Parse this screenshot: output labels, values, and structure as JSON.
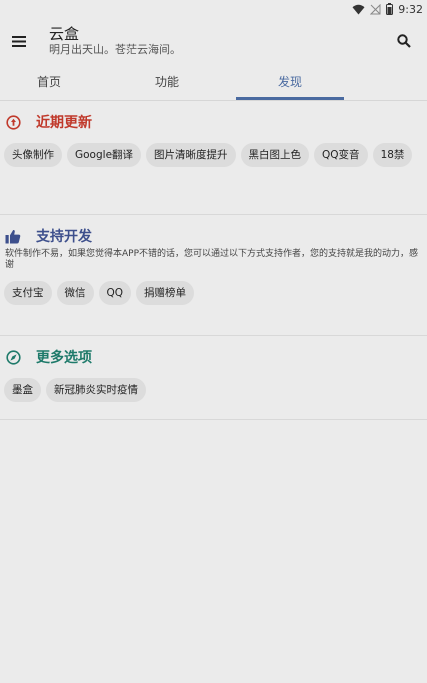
{
  "status": {
    "time": "9:32"
  },
  "app": {
    "title": "云盒",
    "subtitle": "明月出天山。苍茫云海间。"
  },
  "tabs": [
    {
      "label": "首页"
    },
    {
      "label": "功能"
    },
    {
      "label": "发现"
    }
  ],
  "sections": [
    {
      "title": "近期更新",
      "color": "#c0392b",
      "icon": "arrow-up-circle-icon",
      "chips": [
        "头像制作",
        "Google翻译",
        "图片清晰度提升",
        "黑白图上色",
        "QQ变音",
        "18禁"
      ]
    },
    {
      "title": "支持开发",
      "color": "#3d4f8c",
      "icon": "thumbs-up-icon",
      "description": "软件制作不易，如果您觉得本APP不错的话，您可以通过以下方式支持作者，您的支持就是我的动力，感谢",
      "chips": [
        "支付宝",
        "微信",
        "QQ",
        "捐赠榜单"
      ]
    },
    {
      "title": "更多选项",
      "color": "#1e7a6a",
      "icon": "compass-icon",
      "chips": [
        "墨盒",
        "新冠肺炎实时疫情"
      ]
    }
  ],
  "colors": {
    "active_tab": "#4a6aa0",
    "background": "#ebebeb",
    "chip": "#dcdcdc"
  }
}
